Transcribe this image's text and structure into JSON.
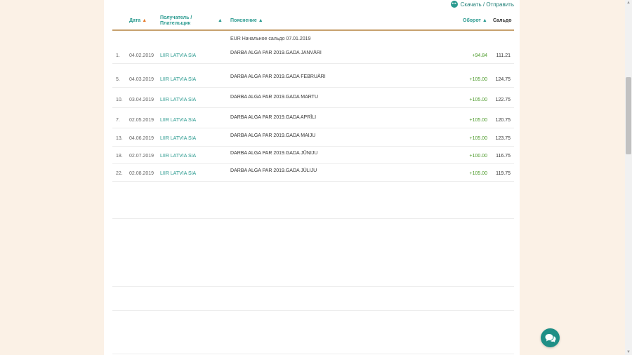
{
  "toolbar": {
    "download_label": "Скачать / Отправить",
    "download_icon": "more-dots-icon"
  },
  "table": {
    "headers": {
      "date": "Дата",
      "payee_line1": "Получатель /",
      "payee_line2": "Плательщик",
      "description": "Пояснение",
      "turnover": "Оборот",
      "balance": "Сальдо"
    },
    "sort_arrows": {
      "date": "▲",
      "payee": "▲",
      "description": "▲",
      "turnover": "▲"
    },
    "opening_balance": "EUR Начальное сальдо 07.01.2019",
    "rows": [
      {
        "num": "1.",
        "date": "04.02.2019",
        "payee": "LIIR LATVIA SIA",
        "description": "DARBA ALGA PAR 2019.GADA JANVĀRI",
        "turnover": "+94.84",
        "balance": "111.21"
      },
      {
        "num": "5.",
        "date": "04.03.2019",
        "payee": "LIIR LATVIA SIA",
        "description": "DARBA ALGA PAR 2019.GADA FEBRUĀRI",
        "turnover": "+105.00",
        "balance": "124.75"
      },
      {
        "num": "10.",
        "date": "03.04.2019",
        "payee": "LIIR LATVIA SIA",
        "description": "DARBA ALGA PAR 2019.GADA MARTU",
        "turnover": "+105.00",
        "balance": "122.75"
      },
      {
        "num": "7.",
        "date": "02.05.2019",
        "payee": "LIIR LATVIA SIA",
        "description": "DARBA ALGA PAR 2019.GADA APRĪLI",
        "turnover": "+105.00",
        "balance": "120.75"
      },
      {
        "num": "13.",
        "date": "04.06.2019",
        "payee": "LIIR LATVIA SIA",
        "description": "DARBA ALGA PAR 2019.GADA MAIJU",
        "turnover": "+105.00",
        "balance": "123.75"
      },
      {
        "num": "18.",
        "date": "02.07.2019",
        "payee": "LIIR LATVIA SIA",
        "description": "DARBA ALGA PAR 2019.GADA JŪNIJU",
        "turnover": "+100.00",
        "balance": "116.75"
      },
      {
        "num": "22.",
        "date": "02.08.2019",
        "payee": "LIIR LATVIA SIA",
        "description": "DARBA ALGA PAR 2019.GADA JŪLIJU",
        "turnover": "+105.00",
        "balance": "119.75"
      }
    ]
  },
  "colors": {
    "accent": "#2a9a8f",
    "positive_amount": "#4c9a2a",
    "sort_arrow_date": "#e77a2a",
    "header_rule": "#c7a16e",
    "page_background": "#fbf1e6"
  },
  "chat": {
    "icon": "chat-bubbles-icon"
  }
}
